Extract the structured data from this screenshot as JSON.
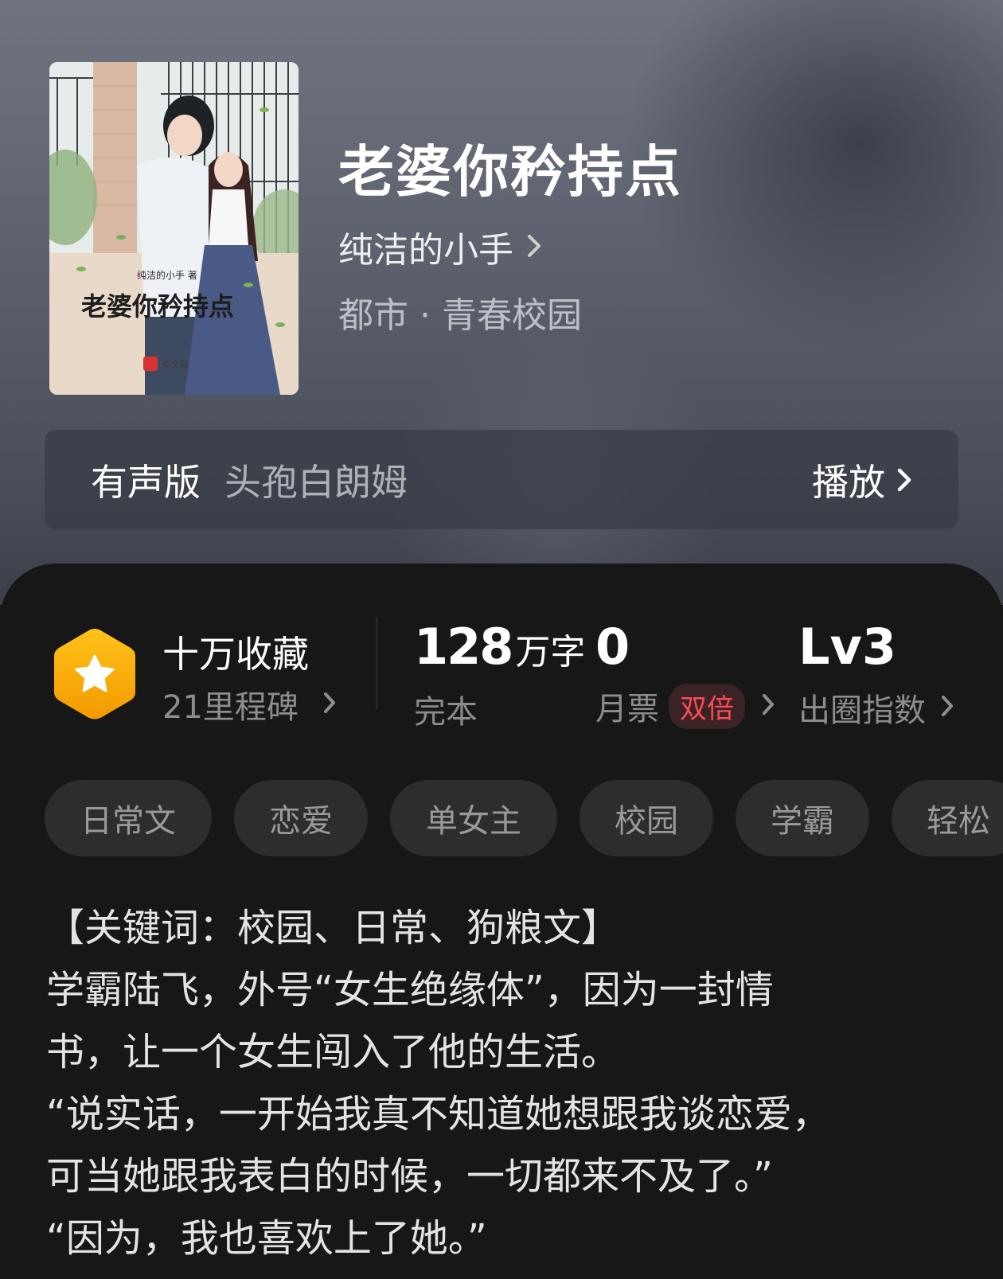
{
  "book": {
    "title": "老婆你矜持点",
    "author": "纯洁的小手",
    "genre": "都市 · 青春校园",
    "cover_text": {
      "author_line": "纯洁的小手 著",
      "title": "老婆你矜持点",
      "publisher": "中文网"
    }
  },
  "audio": {
    "label": "有声版",
    "narrator": "头孢白朗姆",
    "play_label": "播放"
  },
  "stats": {
    "collect_main": "十万收藏",
    "collect_sub": "21里程碑",
    "words_num": "128",
    "words_unit": "万字",
    "status": "完本",
    "ticket_num": "0",
    "ticket_label": "月票",
    "ticket_badge": "双倍",
    "level": "Lv3",
    "level_label": "出圈指数"
  },
  "tags": [
    "日常文",
    "恋爱",
    "单女主",
    "校园",
    "学霸",
    "轻松"
  ],
  "synopsis": [
    "【关键词：校园、日常、狗粮文】",
    "学霸陆飞，外号“女生绝缘体”，因为一封情",
    "书，让一个女生闯入了他的生活。",
    "“说实话，一开始我真不知道她想跟我谈恋爱，",
    "可当她跟我表白的时候，一切都来不及了。”",
    "“因为，我也喜欢上了她。”"
  ],
  "colors": {
    "accent_badge": "#f4b400",
    "double_badge_text": "#ff4a55",
    "panel_bg": "#171717"
  },
  "icons": {
    "chevron": "chevron-right-icon",
    "badge": "star-hexagon-icon"
  }
}
